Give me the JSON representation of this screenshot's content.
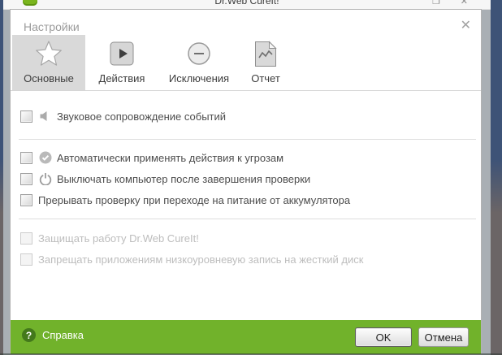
{
  "background_window": {
    "title": "Dr.Web CureIt!"
  },
  "dialog": {
    "title": "Настройки",
    "close_glyph": "✕",
    "tabs": [
      {
        "label": "Основные",
        "icon": "star-icon",
        "selected": true
      },
      {
        "label": "Действия",
        "icon": "play-icon",
        "selected": false
      },
      {
        "label": "Исключения",
        "icon": "minus-circle-icon",
        "selected": false
      },
      {
        "label": "Отчет",
        "icon": "report-icon",
        "selected": false
      }
    ],
    "groups": [
      {
        "items": [
          {
            "label": "Звуковое сопровождение событий",
            "icon": "speaker-icon",
            "checked": false,
            "enabled": true
          }
        ]
      },
      {
        "items": [
          {
            "label": "Автоматически применять действия к угрозам",
            "icon": "check-circle-icon",
            "checked": false,
            "enabled": true
          },
          {
            "label": "Выключать компьютер после завершения проверки",
            "icon": "power-icon",
            "checked": false,
            "enabled": true
          },
          {
            "label": "Прерывать проверку при переходе на питание от аккумулятора",
            "icon": null,
            "checked": false,
            "enabled": true
          }
        ]
      },
      {
        "items": [
          {
            "label": "Защищать работу Dr.Web CureIt!",
            "icon": null,
            "checked": false,
            "enabled": false
          },
          {
            "label": "Запрещать приложениям низкоуровневую запись на жесткий диск",
            "icon": null,
            "checked": false,
            "enabled": false
          }
        ]
      }
    ],
    "footer": {
      "help_label": "Справка",
      "ok_label": "OK",
      "cancel_label": "Отмена",
      "colors": {
        "footer_green": "#71b22b",
        "help_badge_green": "#43791b",
        "selected_tab_bg": "#d9d9d9"
      }
    }
  }
}
